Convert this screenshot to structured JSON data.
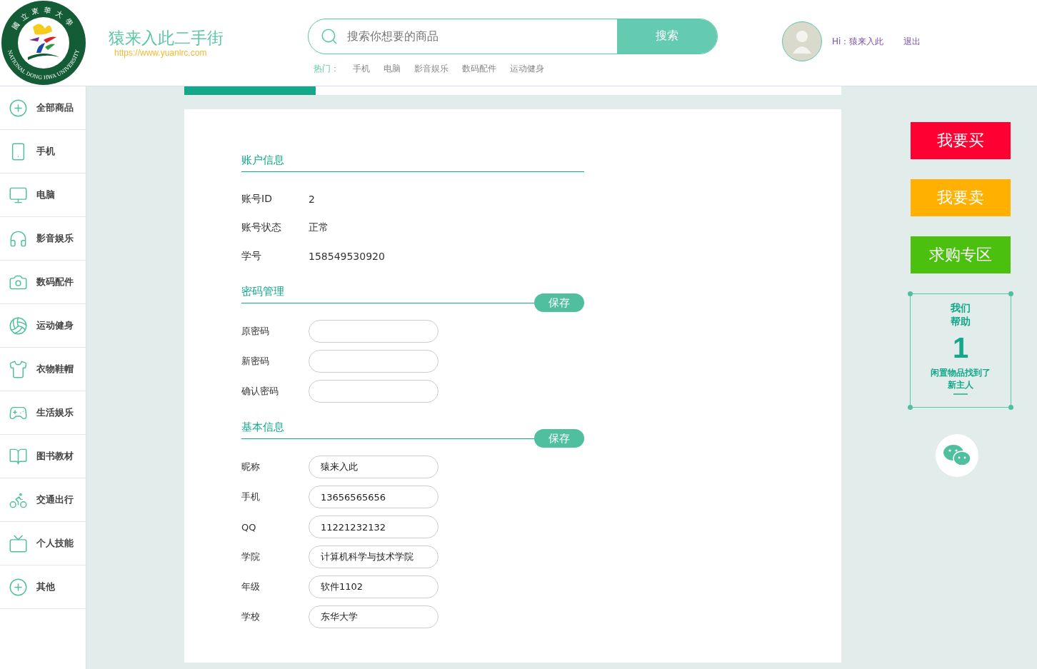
{
  "header": {
    "logo_text_top": "國立東華大學",
    "logo_text_bottom": "NATIONAL DONG HWA UNIVERSITY",
    "site_name": "猿来入此二手街",
    "site_url": "https://www.yuanlrc.com",
    "search": {
      "placeholder": "搜索你想要的商品",
      "button": "搜索"
    },
    "hot_label": "热门：",
    "hot_links": [
      "手机",
      "电脑",
      "影音娱乐",
      "数码配件",
      "运动健身"
    ],
    "greeting": "Hi：猿来入此",
    "logout": "退出"
  },
  "sidebar": {
    "items": [
      {
        "label": "全部商品",
        "kind": "plus"
      },
      {
        "label": "手机",
        "kind": "phone"
      },
      {
        "label": "电脑",
        "kind": "monitor"
      },
      {
        "label": "影音娱乐",
        "kind": "headphones"
      },
      {
        "label": "数码配件",
        "kind": "camera"
      },
      {
        "label": "运动健身",
        "kind": "ball"
      },
      {
        "label": "衣物鞋帽",
        "kind": "shirt"
      },
      {
        "label": "生活娱乐",
        "kind": "gamepad"
      },
      {
        "label": "图书教材",
        "kind": "book"
      },
      {
        "label": "交通出行",
        "kind": "scooter"
      },
      {
        "label": "个人技能",
        "kind": "tv"
      },
      {
        "label": "其他",
        "kind": "plus"
      }
    ]
  },
  "account": {
    "title": "账户信息",
    "rows": [
      {
        "label": "账号ID",
        "value": "2"
      },
      {
        "label": "账号状态",
        "value": "正常"
      },
      {
        "label": "学号",
        "value": "158549530920"
      }
    ]
  },
  "password": {
    "title": "密码管理",
    "save": "保存",
    "fields": [
      {
        "label": "原密码"
      },
      {
        "label": "新密码"
      },
      {
        "label": "确认密码"
      }
    ]
  },
  "basic": {
    "title": "基本信息",
    "save": "保存",
    "fields": [
      {
        "label": "昵称",
        "value": "猿来入此"
      },
      {
        "label": "手机",
        "value": "13656565656"
      },
      {
        "label": "QQ",
        "value": "11221232132"
      },
      {
        "label": "学院",
        "value": "计算机科学与技术学院"
      },
      {
        "label": "年级",
        "value": "软件1102"
      },
      {
        "label": "学校",
        "value": "东华大学"
      }
    ]
  },
  "actions": [
    {
      "label": "我要买",
      "color": "#ff0033"
    },
    {
      "label": "我要卖",
      "color": "#ffb000"
    },
    {
      "label": "求购专区",
      "color": "#4cc00e"
    }
  ],
  "help_card": {
    "title_line1": "我们",
    "title_line2": "帮助",
    "count": "1",
    "caption_line1": "闲置物品找到了",
    "caption_line2": "新主人"
  }
}
